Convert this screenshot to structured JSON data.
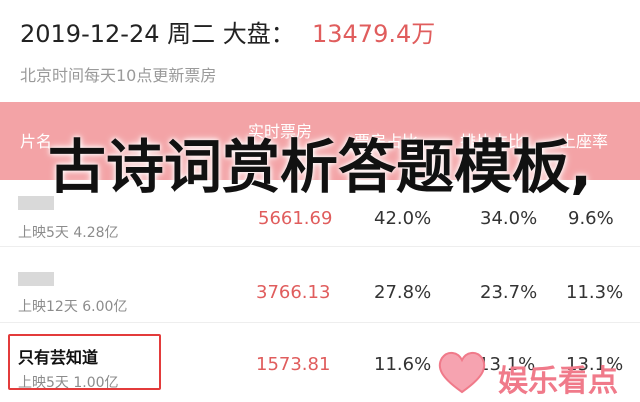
{
  "header": {
    "date": "2019-12-24 周二 大盘：",
    "value": "13479.4万",
    "subtitle": "北京时间每天10点更新票房"
  },
  "table": {
    "headers": [
      "片名",
      "实时票房",
      "票房占比",
      "排片占比",
      "上座率"
    ],
    "rows": [
      {
        "title": "",
        "meta": "上映5天  4.28亿",
        "box": "5661.69",
        "box_share": "42.0%",
        "sched_share": "34.0%",
        "occupancy": "9.6%"
      },
      {
        "title": "",
        "meta": "上映12天  6.00亿",
        "box": "3766.13",
        "box_share": "27.8%",
        "sched_share": "23.7%",
        "occupancy": "11.3%"
      },
      {
        "title": "只有芸知道",
        "meta": "上映5天  1.00亿",
        "box": "1573.81",
        "box_share": "11.6%",
        "sched_share": "13.1%",
        "occupancy": "13.1%"
      }
    ]
  },
  "overlay": {
    "text": "古诗词赏析答题模板,"
  },
  "watermark": {
    "text": "娱乐看点",
    "icon": "heart-icon"
  },
  "colors": {
    "accent_red": "#e05d5d",
    "header_pink": "#f3a3a6",
    "watermark_pink": "#f07a8a"
  }
}
